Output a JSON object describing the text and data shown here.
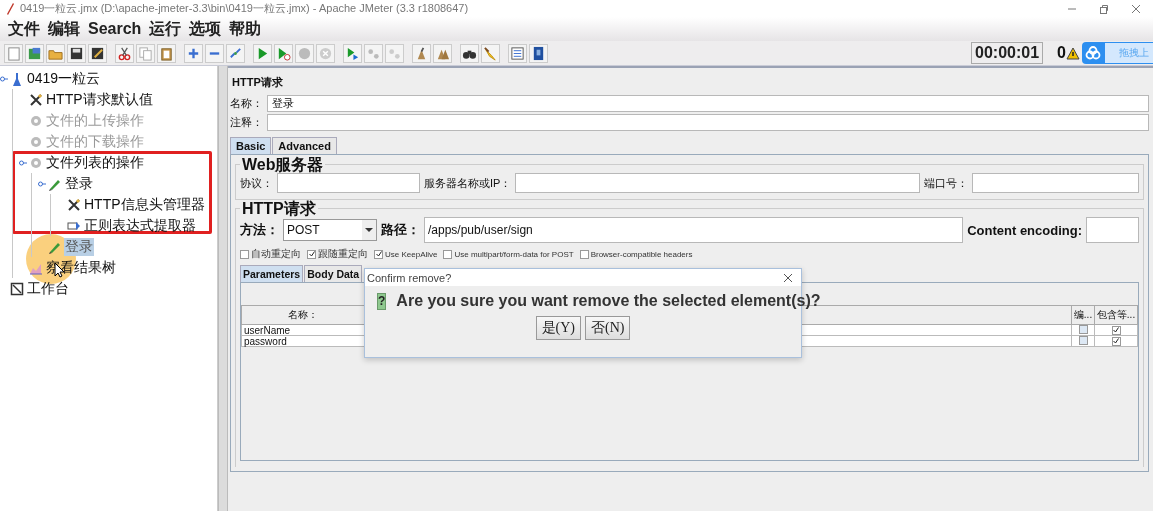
{
  "window": {
    "title": "0419一粒云.jmx (D:\\apache-jmeter-3.3\\bin\\0419一粒云.jmx) - Apache JMeter (3.3 r1808647)"
  },
  "menu": [
    "文件",
    "编辑",
    "Search",
    "运行",
    "选项",
    "帮助"
  ],
  "status": {
    "timer": "00:00:01",
    "warnings": "0"
  },
  "overlay_widget": {
    "label": "拖拽上"
  },
  "tree": [
    {
      "label": "0419一粒云",
      "kind": "plan",
      "disabled": false,
      "selected": false,
      "children": [
        {
          "label": "HTTP请求默认值",
          "kind": "config",
          "disabled": false,
          "selected": false
        },
        {
          "label": "文件的上传操作",
          "kind": "threads",
          "disabled": true,
          "selected": false
        },
        {
          "label": "文件的下载操作",
          "kind": "threads",
          "disabled": true,
          "selected": false
        },
        {
          "label": "文件列表的操作",
          "kind": "threads",
          "disabled": false,
          "selected": false,
          "children": [
            {
              "label": "登录",
              "kind": "sampler",
              "disabled": false,
              "selected": false,
              "children": [
                {
                  "label": "HTTP信息头管理器",
                  "kind": "config",
                  "disabled": false,
                  "selected": false
                },
                {
                  "label": "正则表达式提取器",
                  "kind": "extractor",
                  "disabled": false,
                  "selected": false
                }
              ]
            },
            {
              "label": "登录",
              "kind": "sampler",
              "disabled": true,
              "selected": true
            }
          ]
        },
        {
          "label": "察看结果树",
          "kind": "listener",
          "disabled": false,
          "selected": false
        }
      ]
    },
    {
      "label": "工作台",
      "kind": "workbench",
      "disabled": false,
      "selected": false
    }
  ],
  "editor": {
    "title": "HTTP请求",
    "name_label": "名称：",
    "name_value": "登录",
    "comment_label": "注释：",
    "tabs": [
      {
        "label": "Basic",
        "selected": true
      },
      {
        "label": "Advanced",
        "selected": false
      }
    ],
    "web_server": {
      "title": "Web服务器",
      "fields": [
        {
          "label": "协议："
        },
        {
          "label": "服务器名称或IP："
        },
        {
          "label": "端口号："
        }
      ]
    },
    "http_request": {
      "title": "HTTP请求",
      "method_label": "方法：",
      "method": "POST",
      "path_label": "路径：",
      "path": "/apps/pub/user/sign",
      "encoding_label": "Content encoding:",
      "options": [
        {
          "label": "自动重定向",
          "checked": false
        },
        {
          "label": "跟随重定向",
          "checked": true
        },
        {
          "label": "Use KeepAlive",
          "checked": true
        },
        {
          "label": "Use multipart/form-data for POST",
          "checked": false
        },
        {
          "label": "Browser-compatible headers",
          "checked": false
        }
      ]
    },
    "sub_tabs": [
      {
        "label": "Parameters",
        "selected": true
      },
      {
        "label": "Body Data",
        "selected": false
      }
    ],
    "table": {
      "columns": [
        "名称：",
        "编...",
        "包含等..."
      ],
      "rows": [
        {
          "name": "userName",
          "encode": false,
          "include_equals": true
        },
        {
          "name": "password",
          "encode": false,
          "include_equals": true
        }
      ]
    }
  },
  "dialog": {
    "title": "Confirm remove?",
    "icon": "?",
    "message": "Are you sure you want remove the selected element(s)?",
    "buttons": [
      "是(Y)",
      "否(N)"
    ]
  }
}
